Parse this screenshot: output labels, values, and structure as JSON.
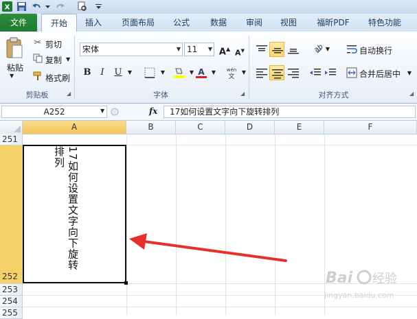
{
  "ribbon_tabs": [
    "文件",
    "开始",
    "插入",
    "页面布局",
    "公式",
    "数据",
    "审阅",
    "视图",
    "福昕PDF",
    "特色功能"
  ],
  "active_tab": "开始",
  "clipboard": {
    "paste": "粘贴",
    "cut": "剪切",
    "copy": "复制",
    "format_painter": "格式刷",
    "group_label": "剪贴板"
  },
  "font": {
    "name": "宋体",
    "size": "11",
    "group_label": "字体"
  },
  "alignment": {
    "wrap_text": "自动换行",
    "merge_center": "合并后居中",
    "group_label": "对齐方式"
  },
  "formula_bar": {
    "name_box": "A252",
    "fx": "fx",
    "formula": "17如何设置文字向下旋转排列"
  },
  "columns": [
    "A",
    "B",
    "C",
    "D",
    "E",
    "F"
  ],
  "selected_column": "A",
  "rows": [
    "251",
    "252",
    "253",
    "254",
    "255"
  ],
  "selected_row": "252",
  "cell_A252_text": "17如何设置文字向下旋转排列",
  "annotation_color": "#e8302a",
  "accent_colors": {
    "file_tab": "#2a8a3a",
    "selection": "#f6d168"
  },
  "watermark": {
    "brand": "Baidu",
    "sub": "经验",
    "url": "jingyan.baidu.com"
  }
}
